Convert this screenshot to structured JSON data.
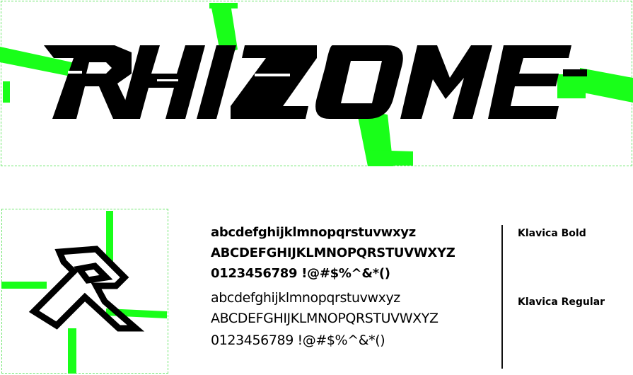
{
  "hero": {
    "word": "RHIZOME"
  },
  "specimen": {
    "bold_lower": "abcdefghijklmnopqrstuvwxyz",
    "bold_upper": "ABCDEFGHIJKLMNOPQRSTUVWXYZ",
    "bold_digits": "0123456789 !@#$%^&*()",
    "regular_lower": "abcdefghijklmnopqrstuvwxyz",
    "regular_upper": "ABCDEFGHIJKLMNOPQRSTUVWXYZ",
    "regular_digits": "0123456789 !@#$%^&*()"
  },
  "font_names": {
    "bold": "Klavica Bold",
    "regular": "Klavica Regular"
  },
  "colors": {
    "accent_green": "#19ff19",
    "ink": "#000000",
    "guide": "#6fe66f"
  },
  "icons": {
    "logo": "rhizome-r-mark"
  }
}
